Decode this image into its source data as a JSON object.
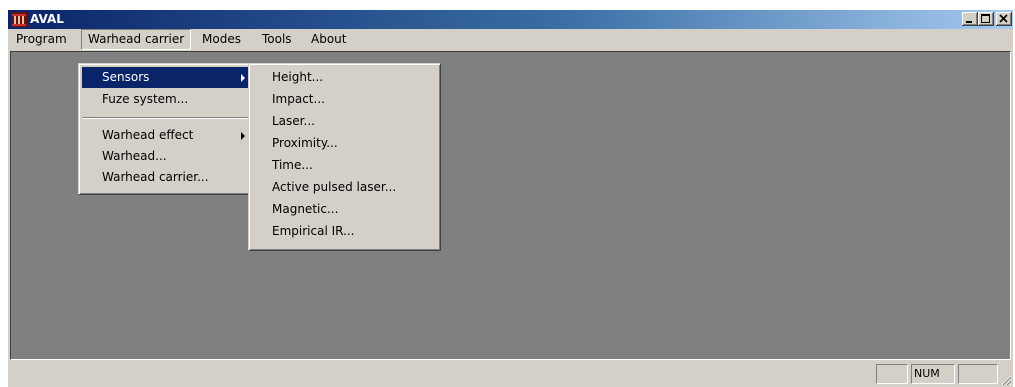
{
  "app": {
    "title": "AVAL",
    "window_buttons": [
      "minimize",
      "maximize",
      "close"
    ]
  },
  "menubar": {
    "items": [
      {
        "label": "Program"
      },
      {
        "label": "Warhead carrier",
        "open": true
      },
      {
        "label": "Modes"
      },
      {
        "label": "Tools"
      },
      {
        "label": "About"
      }
    ]
  },
  "warhead_carrier_menu": {
    "items": [
      {
        "label": "Sensors",
        "submenu": true,
        "highlighted": true
      },
      {
        "label": "Fuze system..."
      },
      {
        "label": "Warhead effect",
        "submenu": true
      },
      {
        "label": "Warhead..."
      },
      {
        "label": "Warhead carrier..."
      }
    ]
  },
  "sensors_submenu": {
    "items": [
      {
        "label": "Height..."
      },
      {
        "label": "Impact..."
      },
      {
        "label": "Laser..."
      },
      {
        "label": "Proximity..."
      },
      {
        "label": "Time..."
      },
      {
        "label": "Active pulsed laser..."
      },
      {
        "label": "Magnetic..."
      },
      {
        "label": "Empirical IR..."
      }
    ]
  },
  "statusbar": {
    "panes": [
      "",
      "NUM",
      ""
    ]
  },
  "colors": {
    "title_gradient_start": "#0a246a",
    "title_gradient_end": "#a6caf0",
    "highlight": "#0a246a",
    "client_bg": "#808080",
    "face": "#d4d0c8"
  }
}
